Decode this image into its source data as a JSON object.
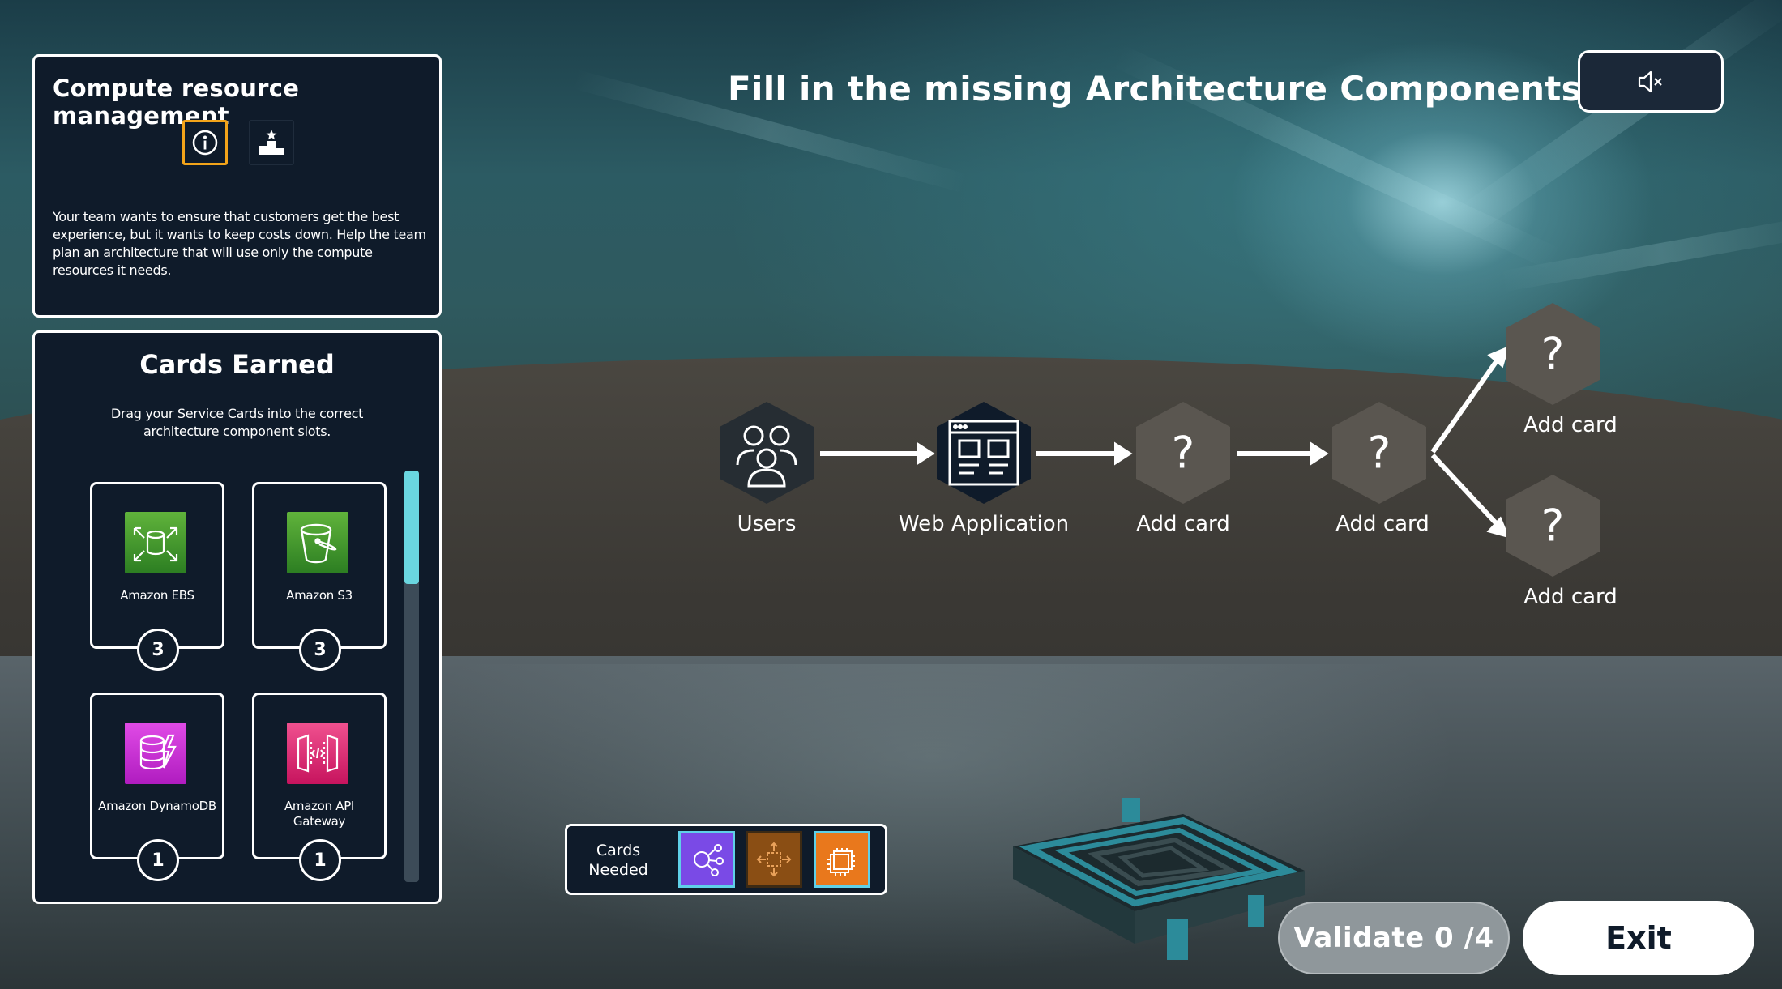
{
  "scenario": {
    "title": "Compute resource management",
    "description": "Your team wants to ensure that customers get the best experience, but it wants to keep costs down. Help the team plan an architecture that will use only the compute resources it needs.",
    "info_icon": "info-circle-icon",
    "leaderboard_icon": "podium-icon"
  },
  "cards_earned": {
    "title": "Cards Earned",
    "instructions": "Drag your Service Cards into the correct architecture component slots.",
    "cards": [
      {
        "name": "Amazon EBS",
        "count": "3",
        "icon": "ebs-icon",
        "color": "#3f9a2d"
      },
      {
        "name": "Amazon S3",
        "count": "3",
        "icon": "s3-bucket-icon",
        "color": "#3f9a2d"
      },
      {
        "name": "Amazon DynamoDB",
        "count": "1",
        "icon": "dynamodb-icon",
        "color": "#c925d1"
      },
      {
        "name": "Amazon API Gateway",
        "count": "1",
        "icon": "api-gateway-icon",
        "color": "#e7157b"
      }
    ]
  },
  "heading": "Fill in the missing Architecture Components",
  "mute_icon": "speaker-muted-icon",
  "diagram": {
    "nodes": [
      {
        "label": "Users",
        "icon": "users-icon"
      },
      {
        "label": "Web Application",
        "icon": "web-application-icon"
      },
      {
        "label": "Add card",
        "symbol": "?"
      },
      {
        "label": "Add card",
        "symbol": "?"
      },
      {
        "label": "Add card",
        "symbol": "?"
      },
      {
        "label": "Add card",
        "symbol": "?"
      }
    ]
  },
  "cards_needed": {
    "label": "Cards Needed",
    "slots": [
      {
        "icon": "network-hub-icon",
        "color": "#7a4ae6"
      },
      {
        "icon": "scaling-arrows-icon",
        "color": "#8a4e14"
      },
      {
        "icon": "ec2-chip-icon",
        "color": "#e9781c"
      }
    ]
  },
  "validate": {
    "label": "Validate 0 /4",
    "placed": 0,
    "total": 4
  },
  "exit": {
    "label": "Exit"
  }
}
